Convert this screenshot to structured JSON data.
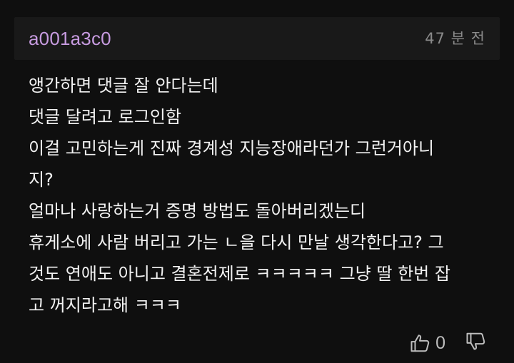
{
  "comment": {
    "username": "a001a3c0",
    "timestamp": "47 분 전",
    "lines": [
      "앵간하면 댓글 잘 안다는데",
      "댓글 달려고 로그인함",
      "이걸 고민하는게 진짜 경계성 지능장애라던가 그런거아니",
      "지?",
      "얼마나 사랑하는거 증명 방법도 돌아버리겠는디",
      "휴게소에 사람 버리고 가는 ㄴ을 다시 만날 생각한다고? 그",
      "것도 연애도 아니고 결혼전제로 ㅋㅋㅋㅋㅋ 그냥 딸 한번 잡",
      "고 꺼지라고해 ㅋㅋㅋ"
    ],
    "like_count": "0",
    "icons": {
      "like": "thumbs-up-icon",
      "dislike": "thumbs-down-icon"
    }
  },
  "colors": {
    "background": "#0f0f0f",
    "header_background": "#191919",
    "username": "#c79be0",
    "text": "#f2f2f2",
    "muted": "#8a8a8a"
  }
}
